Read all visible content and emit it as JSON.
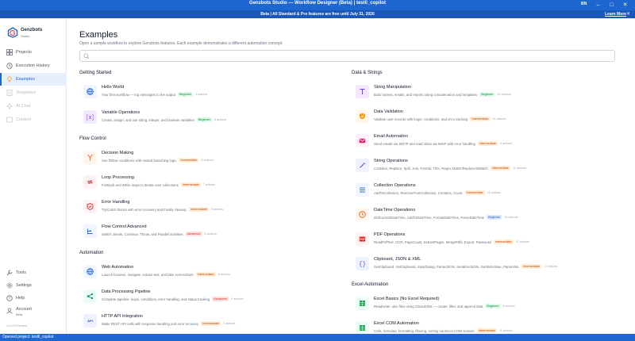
{
  "window": {
    "title": "Genzbots Studio — Workflow Designer (Beta) | testll_copilot",
    "language": "BN"
  },
  "banner": {
    "message": "Beta  |  All Standard & Pro features are free until July 31, 2026",
    "learn_more": "Learn More"
  },
  "brand": {
    "name": "Genzbots",
    "subtitle": "Studio"
  },
  "nav": {
    "projects": "Projects",
    "execution_history": "Execution History",
    "examples": "Examples",
    "templates": "Templates",
    "ai_chat": "AI Chat",
    "content": "Content",
    "tools": "Tools",
    "settings": "Settings",
    "help": "Help",
    "account": "Account",
    "account_status": "Beta"
  },
  "version": "v1.0.0 Preview",
  "status": {
    "text": "Opened project: testll_copilot"
  },
  "colors": {
    "accent": "#1e66d0",
    "beginner": "#15803d",
    "intermediate": "#c2410c",
    "advanced": "#dc2626"
  },
  "page": {
    "title": "Examples",
    "subtitle": "Open a sample workflow to explore Genzbots features. Each example demonstrates a different automation concept.",
    "search_placeholder": ""
  },
  "sections": {
    "getting_started": "Getting Started",
    "flow_control": "Flow Control",
    "automation": "Automation",
    "data_strings": "Data & Strings",
    "excel_automation": "Excel Automation"
  },
  "examples": {
    "hello_world": {
      "name": "Hello World",
      "desc": "Your first workflow — log messages to the output",
      "level": "Beginner",
      "actions": "3 actions"
    },
    "variable_ops": {
      "name": "Variable Operations",
      "desc": "Create, assign, and use string, integer, and boolean variables",
      "level": "Beginner",
      "actions": "6 actions"
    },
    "decision_making": {
      "name": "Decision Making",
      "desc": "Use If/Else conditions with nested branching logic",
      "level": "Intermediate",
      "actions": "5 actions"
    },
    "loop_processing": {
      "name": "Loop Processing",
      "desc": "ForEach and While loops to iterate over collections",
      "level": "Intermediate",
      "actions": "7 actions"
    },
    "error_handling": {
      "name": "Error Handling",
      "desc": "Try/Catch blocks with error recovery and Finally cleanup",
      "level": "Intermediate",
      "actions": "5 actions"
    },
    "flow_control_adv": {
      "name": "Flow Control Advanced",
      "desc": "Switch, Break, Continue, Throw, and Parallel activities",
      "level": "Advanced",
      "actions": "8 actions"
    },
    "web_automation": {
      "name": "Web Automation",
      "desc": "Launch browser, navigate, extract text, and take screenshots",
      "level": "Intermediate",
      "actions": "6 actions"
    },
    "data_pipeline": {
      "name": "Data Processing Pipeline",
      "desc": "Complete pipeline: loops, conditions, error handling, and status tracking",
      "level": "Advanced",
      "actions": "9 actions"
    },
    "http_api": {
      "name": "HTTP API Integration",
      "desc": "Make REST API calls with response handling and error recovery",
      "level": "Intermediate",
      "actions": "5 actions"
    },
    "string_manip": {
      "name": "String Manipulation",
      "desc": "Build names, emails, and reports using concatenation and templates",
      "level": "Beginner",
      "actions": "10 actions"
    },
    "data_validation": {
      "name": "Data Validation",
      "desc": "Validate user records with loops, conditions, and error tracking",
      "level": "Intermediate",
      "actions": "11 actions"
    },
    "email_automation": {
      "name": "Email Automation",
      "desc": "Send emails via SMTP and read inbox via IMAP with error handling",
      "level": "Intermediate",
      "actions": "4 actions"
    },
    "string_ops": {
      "name": "String Operations",
      "desc": "Contains, Replace, Split, Join, Format, Trim, Regex Match/Replace/IsMatch",
      "level": "Intermediate",
      "actions": "12 actions"
    },
    "collection_ops": {
      "name": "Collection Operations",
      "desc": "AddToCollection, RemoveFromCollection, Contains, Count",
      "level": "Intermediate",
      "actions": "10 actions"
    },
    "datetime_ops": {
      "name": "DateTime Operations",
      "desc": "GetCurrentDateTime, AddToDateTime, FormatDateTime, ParseDateTime",
      "level": "Beginner",
      "actions": "10 actions"
    },
    "pdf_ops": {
      "name": "PDF Operations",
      "desc": "ReadPdfText, OCR, PageCount, ExtractPages, MergePdfs, Export, Password",
      "level": "Intermediate",
      "actions": "11 actions"
    },
    "clipboard_json": {
      "name": "Clipboard, JSON & XML",
      "desc": "GetClipboard, SetClipboard, InputDialog, ParseJSON, SerializeJSON, GetXMLValue, ParseXML",
      "level": "Intermediate",
      "actions": "17 actions"
    },
    "excel_basics": {
      "name": "Excel Basics (No Excel Required)",
      "desc": "Read/write .xlsx files using ClosedXML — create, filter, and append data",
      "level": "Beginner",
      "actions": "8 actions"
    },
    "excel_com": {
      "name": "Excel COM Automation",
      "desc": "Cells, formulas, formatting, filtering, sorting via Excel COM session",
      "level": "Intermediate",
      "actions": "11 actions"
    }
  }
}
